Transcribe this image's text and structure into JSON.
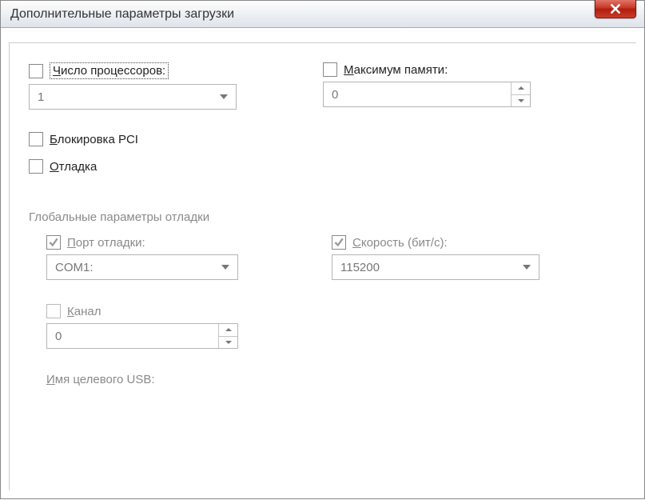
{
  "title": "Дополнительные параметры загрузки",
  "proc_count": {
    "label_pre": "Ч",
    "label_post": "исло процессоров:",
    "value": "1"
  },
  "max_mem": {
    "label_pre": "М",
    "label_post": "аксимум памяти:",
    "value": "0"
  },
  "pci_lock": {
    "label_pre": "Б",
    "label_post": "локировка PCI"
  },
  "debug": {
    "label_pre": "О",
    "label_post": "тладка"
  },
  "global_title": "Глобальные параметры отладки",
  "debug_port": {
    "label_pre": "П",
    "label_post": "орт отладки:",
    "value": "COM1:"
  },
  "speed": {
    "label_pre": "С",
    "label_post": "корость (бит/с):",
    "value": "115200"
  },
  "channel": {
    "label_pre": "К",
    "label_post": "анал",
    "value": "0"
  },
  "usb_target": {
    "label_pre": "И",
    "label_post": "мя целевого USB:"
  }
}
